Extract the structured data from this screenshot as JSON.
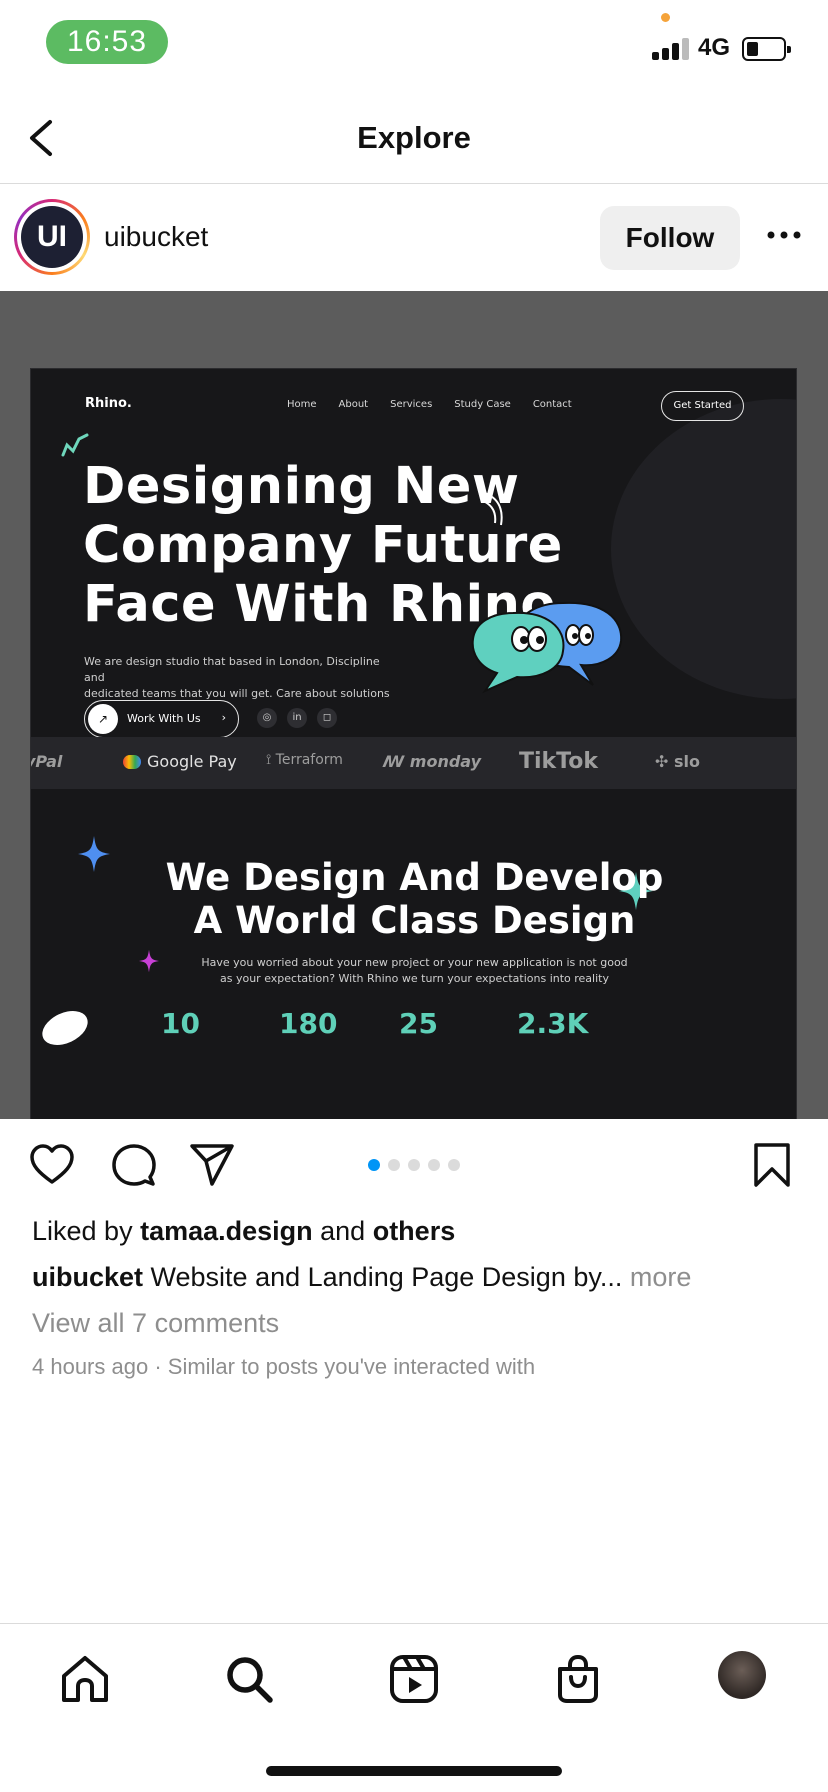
{
  "status_bar": {
    "time": "16:53",
    "network": "4G"
  },
  "header": {
    "title": "Explore"
  },
  "post": {
    "username": "uibucket",
    "avatar_text": "UI",
    "follow_label": "Follow",
    "carousel": {
      "count": 5,
      "active_index": 0
    },
    "media": {
      "logo": "Rhino.",
      "nav": [
        "Home",
        "About",
        "Services",
        "Study Case",
        "Contact"
      ],
      "cta": "Get Started",
      "hero_line1": "Designing New",
      "hero_line2": "Company Future",
      "hero_line3": "Face With Rhino",
      "hero_desc_line1": "We are design studio that based in London, Discipline and",
      "hero_desc_line2": "dedicated teams that you will get. Care about solutions",
      "work_button": "Work With Us",
      "brand_logos": [
        "yPal",
        "Google Pay",
        "Terraform",
        "monday",
        "TikTok",
        "slo"
      ],
      "section2_line1": "We Design And Develop",
      "section2_line2": "A World Class Design",
      "section2_desc_line1": "Have you worried about your new project or your new application is not good",
      "section2_desc_line2": "as your expectation? With Rhino we turn your expectations into reality",
      "stats": [
        "10",
        "180",
        "25",
        "2.3K"
      ]
    },
    "likes": {
      "prefix": "Liked by ",
      "user": "tamaa.design",
      "middle": " and ",
      "others": "others"
    },
    "caption": {
      "username": "uibucket",
      "text": " Website and Landing Page Design by...",
      "more": " more"
    },
    "comments_link": "View all 7 comments",
    "time_ago": "4 hours ago",
    "separator": " · ",
    "context": "Similar to posts you've interacted with"
  },
  "colors": {
    "follow_bg": "#efefef",
    "active_dot": "#0095f6",
    "muted_text": "#8e8e8e",
    "time_pill": "#5cbb62"
  },
  "tab_bar": {
    "items": [
      "home-icon",
      "search-icon",
      "reels-icon",
      "shop-icon",
      "profile-avatar"
    ]
  }
}
